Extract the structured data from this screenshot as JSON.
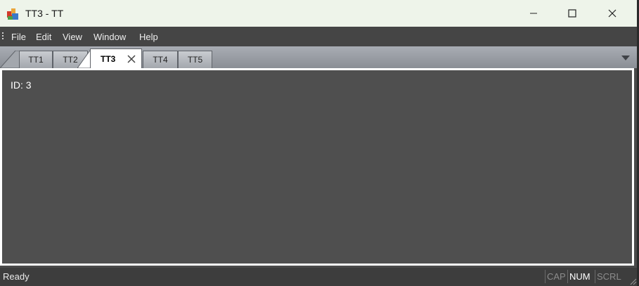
{
  "window": {
    "title": "TT3 - TT"
  },
  "menu": {
    "items": [
      "File",
      "Edit",
      "View",
      "Window",
      "Help"
    ]
  },
  "tabs": [
    {
      "label": "TT1",
      "active": false
    },
    {
      "label": "TT2",
      "active": false
    },
    {
      "label": "TT3",
      "active": true
    },
    {
      "label": "TT4",
      "active": false
    },
    {
      "label": "TT5",
      "active": false
    }
  ],
  "content": {
    "id_text": "ID: 3"
  },
  "status": {
    "text": "Ready",
    "indicators": [
      {
        "label": "CAP",
        "on": false
      },
      {
        "label": "NUM",
        "on": true
      },
      {
        "label": "SCRL",
        "on": false
      }
    ]
  },
  "icons": {
    "app": "app-icon",
    "minimize": "minimize-icon",
    "maximize": "maximize-icon",
    "close": "close-icon",
    "tab_close": "close-icon",
    "overflow": "chevron-down-icon"
  }
}
